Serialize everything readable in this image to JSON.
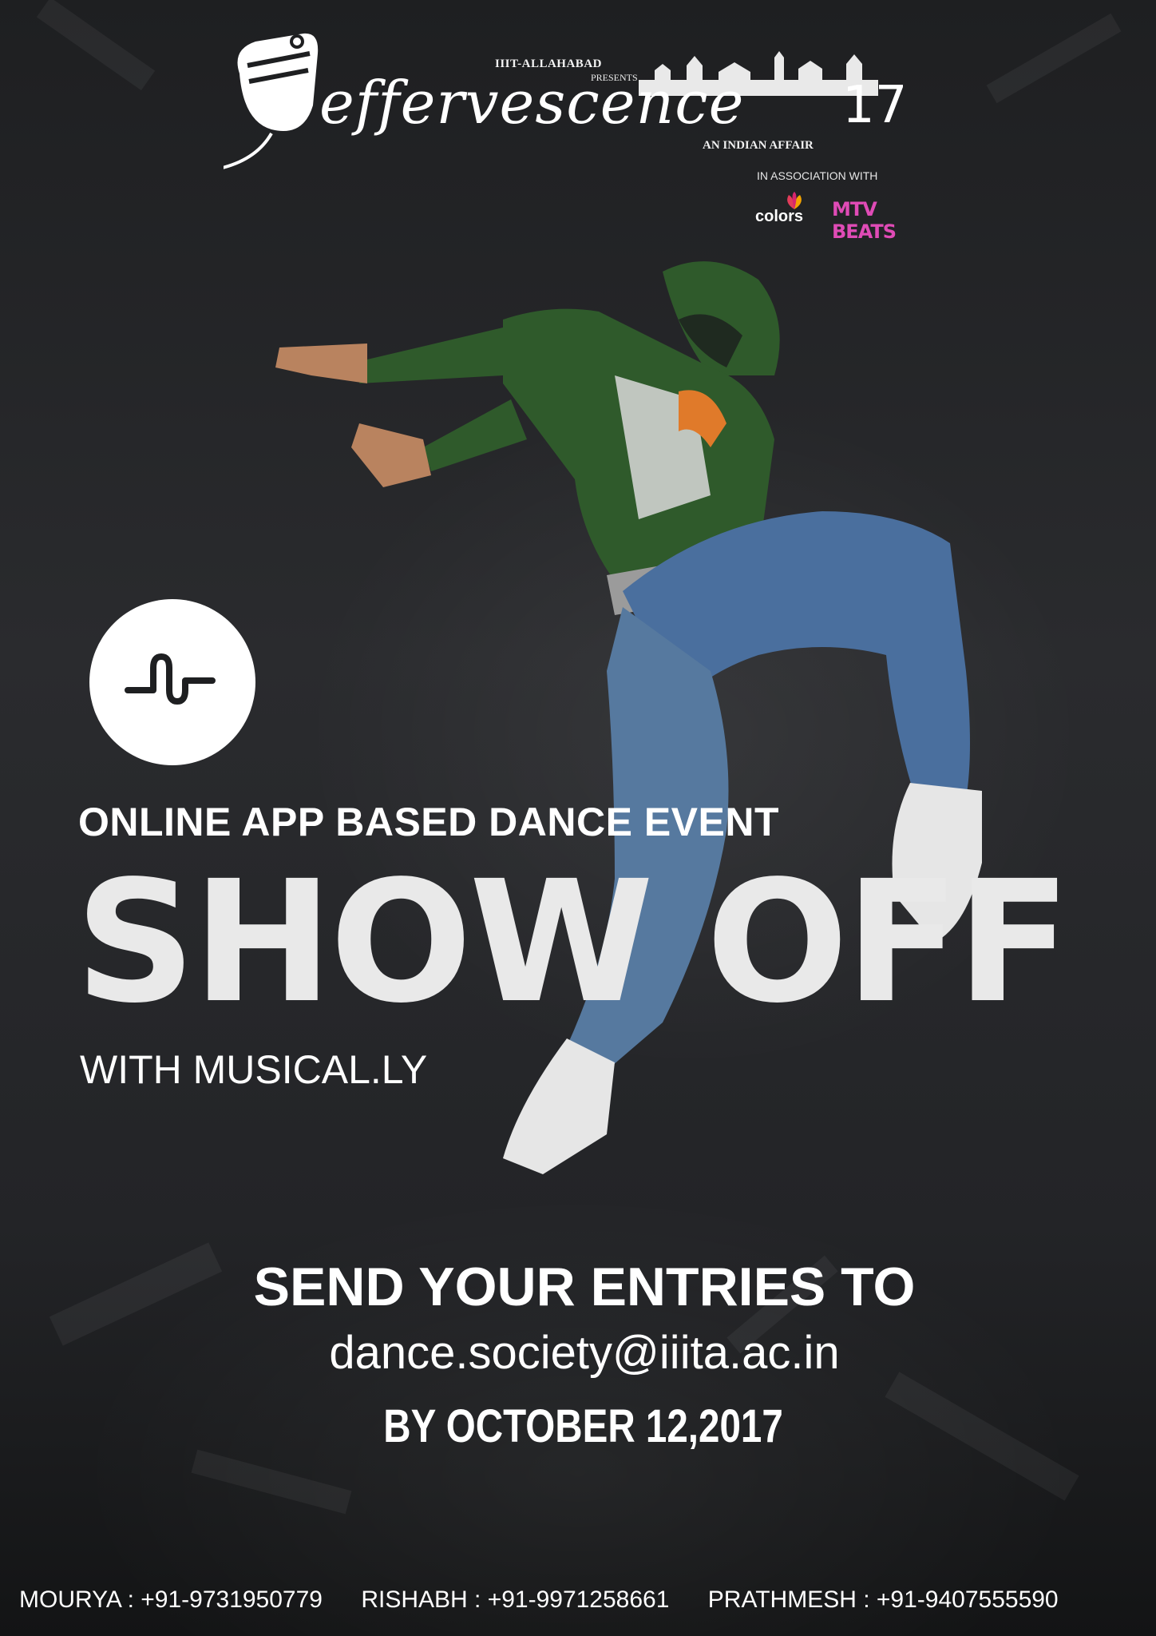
{
  "header": {
    "presenter": "IIIT-ALLAHABAD",
    "presents": "PRESENTS",
    "fest_name": "effervescence",
    "fest_year": "17",
    "tagline": "AN INDIAN AFFAIR",
    "association": "IN ASSOCIATION WITH",
    "sponsors": [
      "colors",
      "MTV BEATS"
    ]
  },
  "event": {
    "app_icon": "musically-logo-icon",
    "subtitle": "ONLINE APP BASED DANCE EVENT",
    "title": "SHOW OFF",
    "with_app": "WITH MUSICAL.LY"
  },
  "entries": {
    "label": "SEND YOUR ENTRIES TO",
    "email": "dance.society@iiita.ac.in",
    "deadline": "BY OCTOBER 12,2017"
  },
  "contacts": [
    "MOURYA : +91-9731950779",
    "RISHABH : +91-9971258661",
    "PRATHMESH : +91-9407555590"
  ],
  "colors": {
    "background": "#1e1f21",
    "text": "#ffffff",
    "hoodie": "#2f5a2b",
    "jeans": "#4a6f9e"
  }
}
